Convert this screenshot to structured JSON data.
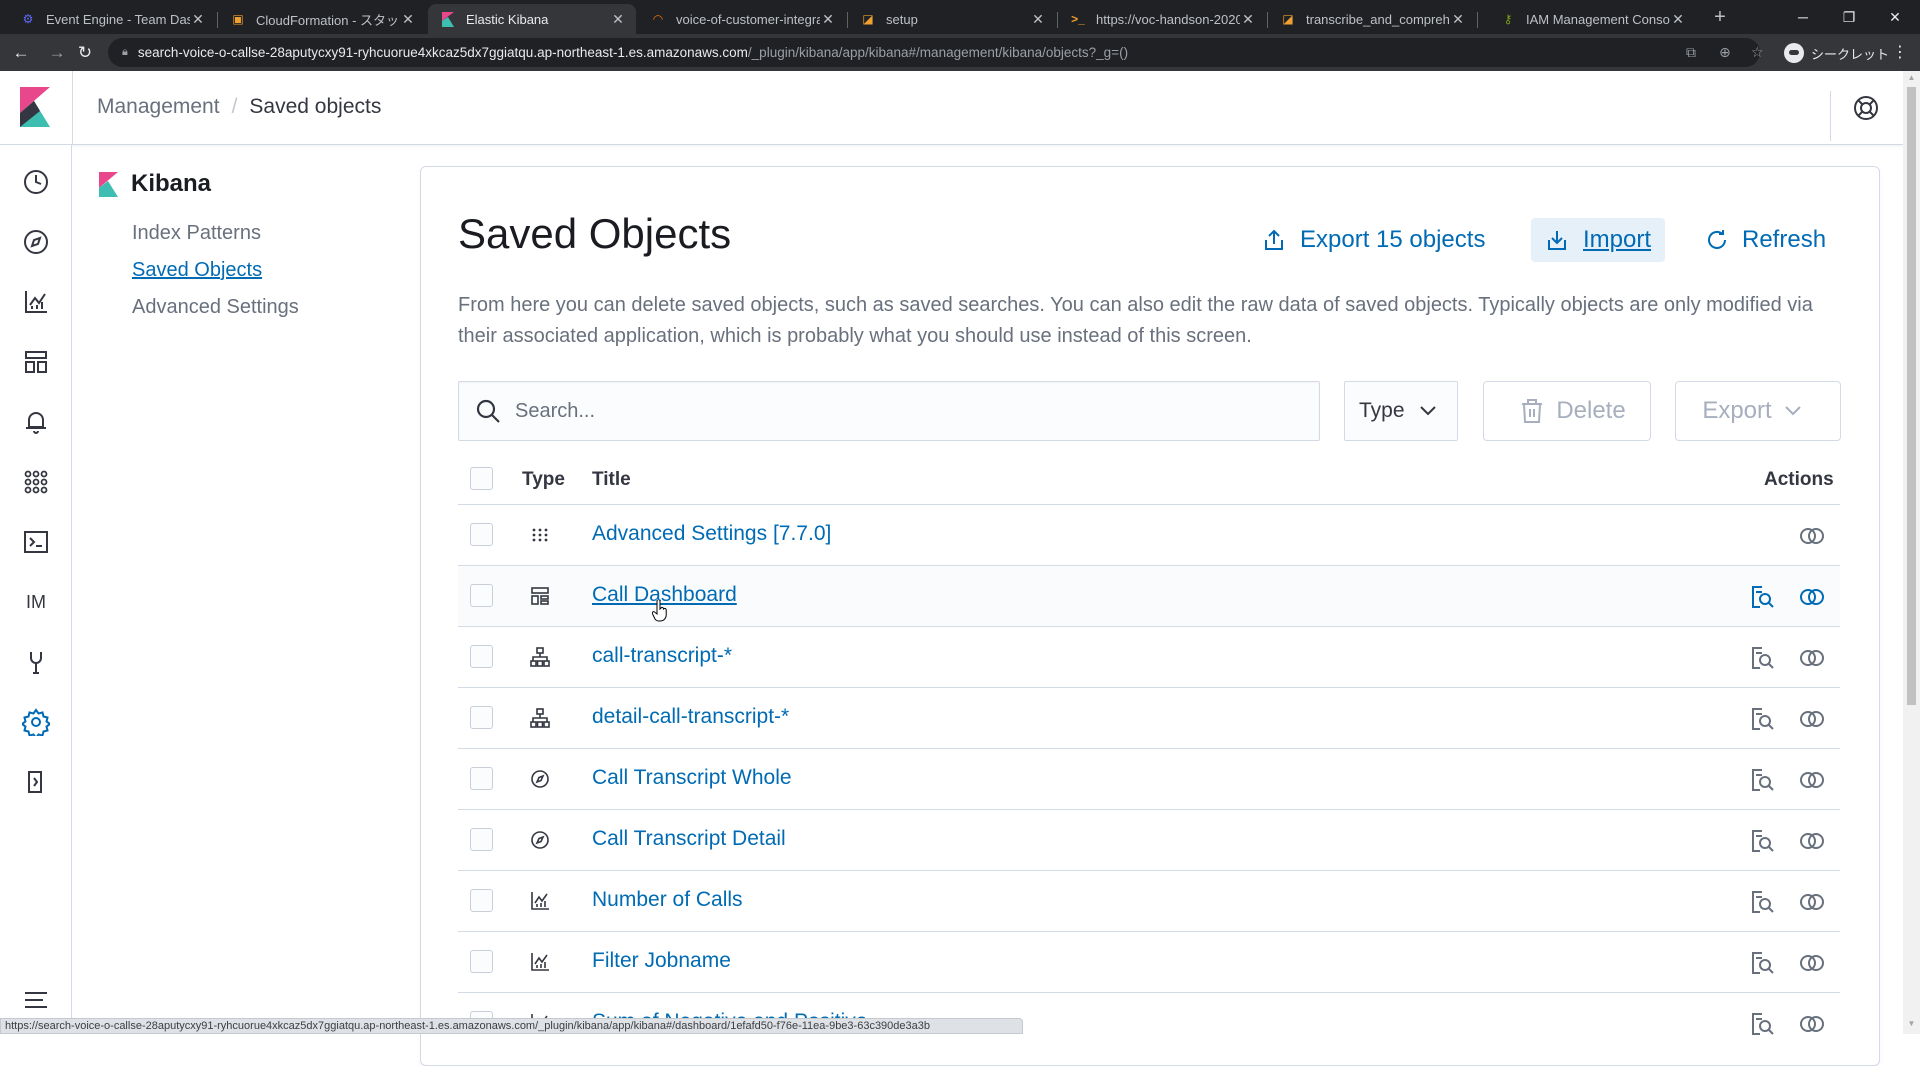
{
  "browser": {
    "tabs": [
      {
        "title": "Event Engine - Team Dashb",
        "favicon": "aws-icon",
        "color": "#5f6bff"
      },
      {
        "title": "CloudFormation - スタック vo",
        "favicon": "cloudformation-icon",
        "color": "#f0a030"
      },
      {
        "title": "Elastic Kibana",
        "favicon": "kibana-icon",
        "color": "#e8478b"
      },
      {
        "title": "voice-of-customer-integrat",
        "favicon": "loading-icon",
        "color": "#e8710a"
      },
      {
        "title": "setup",
        "favicon": "notebook-icon",
        "color": "#f0a030"
      },
      {
        "title": "https://voc-handson-2020",
        "favicon": "terminal-icon",
        "color": "#f0a030"
      },
      {
        "title": "transcribe_and_comprehend",
        "favicon": "notebook-icon",
        "color": "#f0a030"
      },
      {
        "title": "IAM Management Console",
        "favicon": "iam-icon",
        "color": "#7aa116"
      }
    ],
    "active_tab": 2,
    "url_host": "search-voice-o-callse-28aputycxy91-ryhcuorue4xkcaz5dx7ggiatqu.ap-northeast-1.es.amazonaws.com",
    "url_path": "/_plugin/kibana/app/kibana#/management/kibana/objects?_g=()",
    "profile_label": "シークレット",
    "status_url": "https://search-voice-o-callse-28aputycxy91-ryhcuorue4xkcaz5dx7ggiatqu.ap-northeast-1.es.amazonaws.com/_plugin/kibana/app/kibana#/dashboard/1efafd50-f76e-11ea-9be3-63c390de3a3b"
  },
  "header": {
    "breadcrumb_parent": "Management",
    "breadcrumb_current": "Saved objects"
  },
  "sidebar": {
    "title": "Kibana",
    "items": [
      {
        "label": "Index Patterns",
        "active": false
      },
      {
        "label": "Saved Objects",
        "active": true
      },
      {
        "label": "Advanced Settings",
        "active": false
      }
    ]
  },
  "leftnav": {
    "items": [
      "recent-icon",
      "discover-icon",
      "visualize-icon",
      "dashboard-icon",
      "alerts-icon",
      "apps-icon",
      "dev-tools-console-icon",
      "im-icon",
      "monitoring-icon",
      "management-icon",
      "logout-icon",
      "collapse-menu-icon"
    ],
    "im_label": "IM"
  },
  "main": {
    "title": "Saved Objects",
    "export_label": "Export 15 objects",
    "import_label": "Import",
    "refresh_label": "Refresh",
    "description": "From here you can delete saved objects, such as saved searches. You can also edit the raw data of saved objects. Typically objects are only modified via their associated application, which is probably what you should use instead of this screen.",
    "search_placeholder": "Search...",
    "type_filter_label": "Type",
    "delete_label": "Delete",
    "export_menu_label": "Export"
  },
  "table": {
    "headers": {
      "type": "Type",
      "title": "Title",
      "actions": "Actions"
    },
    "rows": [
      {
        "type": "config",
        "icon": "advanced-settings-icon",
        "title": "Advanced Settings [7.7.0]",
        "inspect": false,
        "hover": false
      },
      {
        "type": "dashboard",
        "icon": "dashboard-icon",
        "title": "Call Dashboard",
        "inspect": true,
        "hover": true
      },
      {
        "type": "index-pattern",
        "icon": "index-pattern-icon",
        "title": "call-transcript-*",
        "inspect": true,
        "hover": false
      },
      {
        "type": "index-pattern",
        "icon": "index-pattern-icon",
        "title": "detail-call-transcript-*",
        "inspect": true,
        "hover": false
      },
      {
        "type": "search",
        "icon": "discover-icon",
        "title": "Call Transcript Whole",
        "inspect": true,
        "hover": false
      },
      {
        "type": "search",
        "icon": "discover-icon",
        "title": "Call Transcript Detail",
        "inspect": true,
        "hover": false
      },
      {
        "type": "visualization",
        "icon": "visualize-icon",
        "title": "Number of Calls",
        "inspect": true,
        "hover": false
      },
      {
        "type": "visualization",
        "icon": "visualize-icon",
        "title": "Filter Jobname",
        "inspect": true,
        "hover": false
      },
      {
        "type": "visualization",
        "icon": "visualize-icon",
        "title": "Sum of Negative and Positive",
        "inspect": true,
        "hover": false
      }
    ]
  },
  "colors": {
    "accent": "#006bb4",
    "kibana_pink": "#e8478b",
    "kibana_teal": "#3ebeb0",
    "chrome_dark": "#202124"
  }
}
